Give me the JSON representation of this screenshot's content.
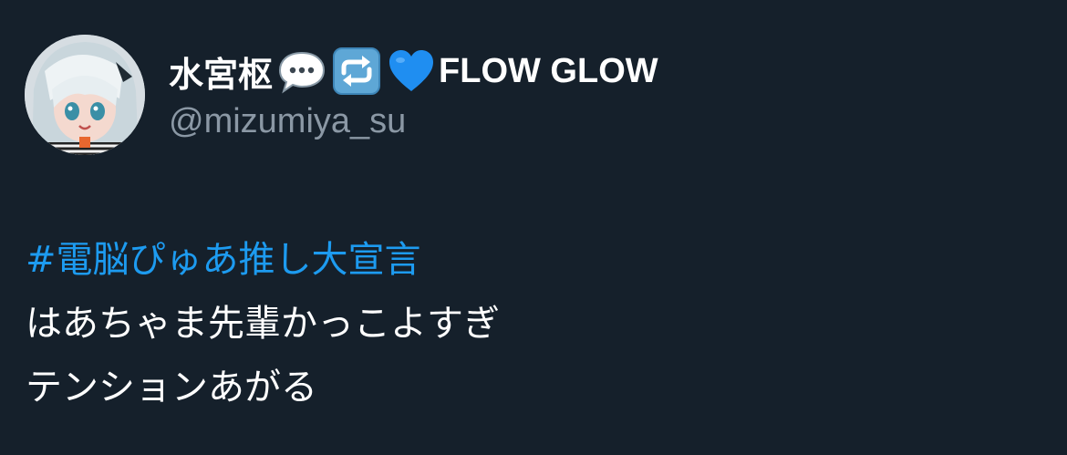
{
  "author": {
    "display_name": "水宮枢",
    "name_emojis": [
      "speech-balloon-emoji",
      "repeat-arrows-emoji",
      "blue-heart-emoji"
    ],
    "name_suffix": "FLOW GLOW",
    "handle": "@mizumiya_su"
  },
  "tweet": {
    "hashtag": "#電脳ぴゅあ推し大宣言",
    "lines": [
      "はあちゃま先輩かっこよすぎ",
      "テンションあがる"
    ]
  },
  "colors": {
    "background": "#15202b",
    "text": "#ffffff",
    "secondary_text": "#8b98a5",
    "link": "#1d9bf0"
  }
}
